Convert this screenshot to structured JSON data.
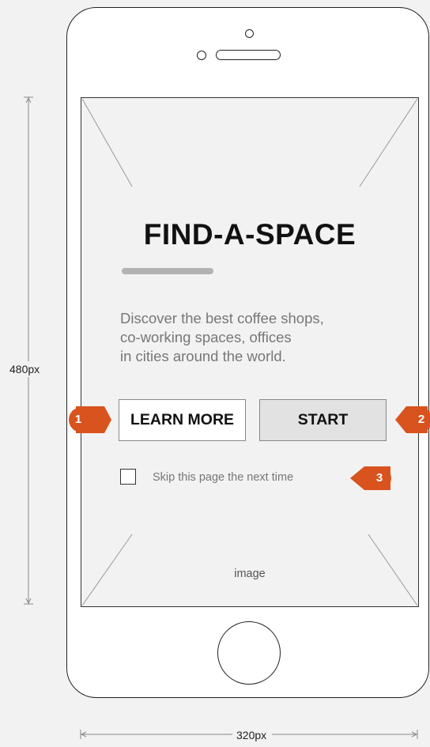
{
  "app": {
    "title": "FIND-A-SPACE",
    "description_lines": [
      "Discover the best coffee shops,",
      "co-working spaces, offices",
      "in cities around the world."
    ],
    "learn_more_label": "LEARN MORE",
    "start_label": "START",
    "skip_checkbox": {
      "label": "Skip this page the next time",
      "checked": false
    },
    "image_placeholder_label": "image"
  },
  "annotations": {
    "height_label": "480px",
    "width_label": "320px",
    "markers": [
      "1",
      "2",
      "3"
    ]
  },
  "colors": {
    "background": "#f2f2f2",
    "accent_marker": "#d9531e",
    "start_button_bg": "#e2e2e2",
    "title_bar": "#b3b3b3"
  },
  "icons": {
    "callout_marker": "callout-marker-icon",
    "checkbox": "checkbox-empty-icon"
  }
}
